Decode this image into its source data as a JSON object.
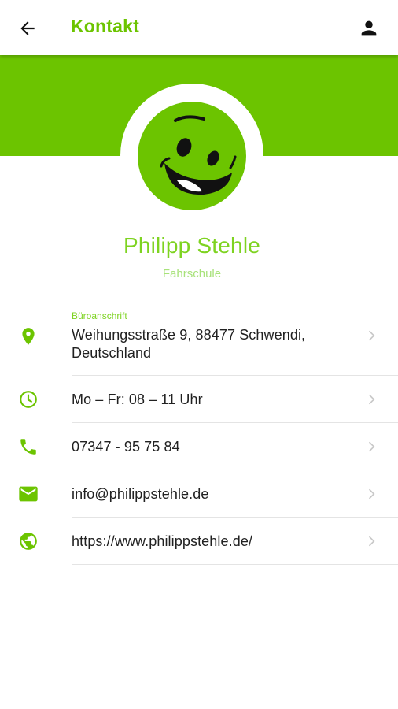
{
  "colors": {
    "accent": "#6cc400",
    "accent_light": "#9be35a",
    "text": "#212121",
    "chevron": "#c8c8c8",
    "divider": "#e4e4e4"
  },
  "header": {
    "title": "Kontakt",
    "back_icon": "arrow-left-icon",
    "profile_icon": "person-icon"
  },
  "profile": {
    "avatar_icon": "smiley-face-logo",
    "name": "Philipp Stehle",
    "subtitle": "Fahrschule"
  },
  "contact": {
    "address_label": "Büroanschrift",
    "address_line1": "Weihungsstraße 9, 88477 Schwendi,",
    "address_line2": "Deutschland",
    "hours": "Mo – Fr: 08 – 11 Uhr",
    "phone": "07347 - 95 75 84",
    "email": "info@philippstehle.de",
    "website": "https://www.philippstehle.de/"
  },
  "icons": {
    "address": "location-pin-icon",
    "hours": "clock-icon",
    "phone": "phone-icon",
    "email": "mail-icon",
    "website": "globe-icon",
    "chevron": "chevron-right-icon"
  }
}
